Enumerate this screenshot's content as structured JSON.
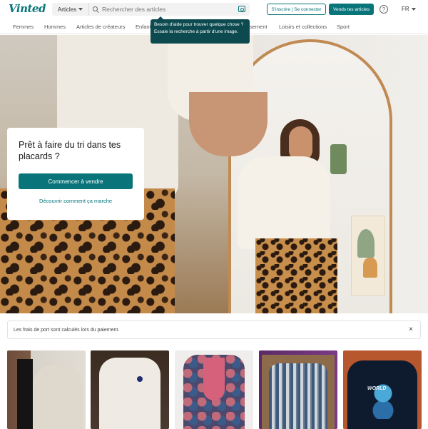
{
  "brand": {
    "logo": "Vinted",
    "accent": "#09757a"
  },
  "search": {
    "category": "Articles",
    "placeholder": "Rechercher des articles",
    "tooltip": "Besoin d'aide pour trouver quelque chose ? Essaie la recherche à partir d'une image."
  },
  "header": {
    "login_label": "S'inscrire | Se connecter",
    "sell_label": "Vends tes articles",
    "help_icon": "?",
    "language": "FR"
  },
  "nav": {
    "items": [
      {
        "label": "Femmes"
      },
      {
        "label": "Hommes"
      },
      {
        "label": "Articles de créateurs"
      },
      {
        "label": "Enfant"
      },
      {
        "label": "sement"
      },
      {
        "label": "Loisirs et collections"
      },
      {
        "label": "Sport"
      }
    ]
  },
  "hero": {
    "title": "Prêt à faire du tri dans tes placards ?",
    "start_label": "Commencer à vendre",
    "discover_label": "Découvrir comment ça marche"
  },
  "notice": {
    "text": "Les frais de port sont calculés lors du paiement.",
    "close": "×"
  },
  "products": {
    "p5_print": "WORLD"
  }
}
